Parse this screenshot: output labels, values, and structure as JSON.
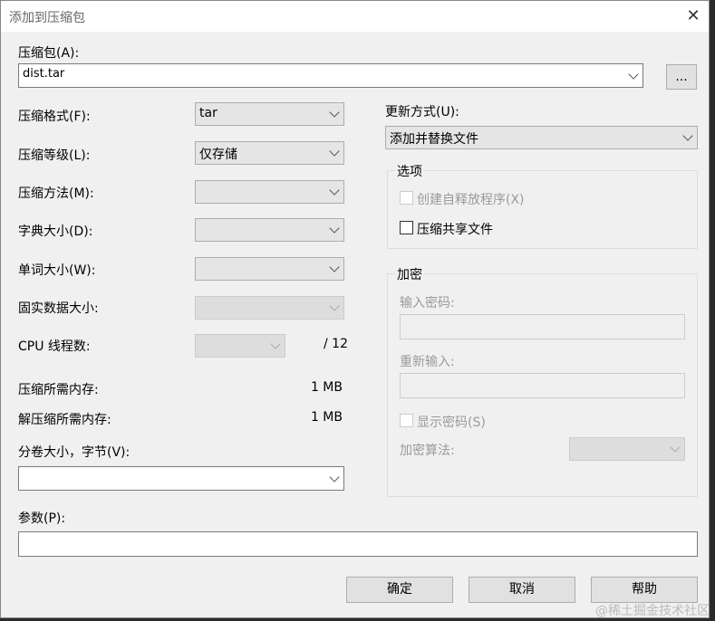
{
  "window": {
    "title": "添加到压缩包",
    "close": "✕"
  },
  "archive": {
    "label": "压缩包(A):",
    "value": "dist.tar",
    "browse": "..."
  },
  "left": {
    "format": {
      "label": "压缩格式(F):",
      "value": "tar"
    },
    "level": {
      "label": "压缩等级(L):",
      "value": "仅存储"
    },
    "method": {
      "label": "压缩方法(M):",
      "value": ""
    },
    "dict": {
      "label": "字典大小(D):",
      "value": ""
    },
    "word": {
      "label": "单词大小(W):",
      "value": ""
    },
    "solid": {
      "label": "固实数据大小:",
      "value": ""
    },
    "cpu": {
      "label": "CPU 线程数:",
      "value": "",
      "max": "/ 12"
    },
    "mem_compress": {
      "label": "压缩所需内存:",
      "value": "1 MB"
    },
    "mem_decompress": {
      "label": "解压缩所需内存:",
      "value": "1 MB"
    },
    "volume": {
      "label": "分卷大小，字节(V):",
      "value": ""
    },
    "params": {
      "label": "参数(P):",
      "value": ""
    }
  },
  "right": {
    "update": {
      "label": "更新方式(U):",
      "value": "添加并替换文件"
    },
    "options": {
      "title": "选项",
      "sfx": "创建自释放程序(X)",
      "shared": "压缩共享文件"
    },
    "encryption": {
      "title": "加密",
      "password": "输入密码:",
      "reenter": "重新输入:",
      "show": "显示密码(S)",
      "method": "加密算法:"
    }
  },
  "buttons": {
    "ok": "确定",
    "cancel": "取消",
    "help": "帮助"
  },
  "watermark": "@稀土掘金技术社区"
}
